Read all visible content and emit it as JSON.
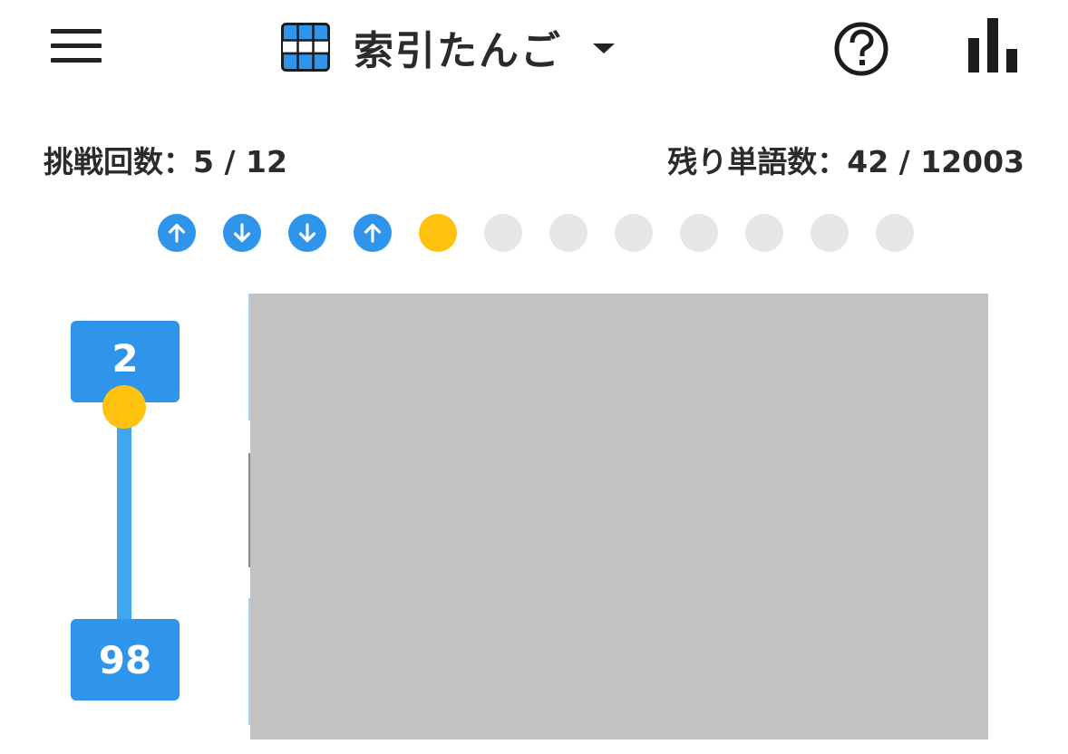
{
  "header": {
    "title": "索引たんご",
    "icons": {
      "menu": "hamburger-menu-icon",
      "mode": "grid-icon",
      "dropdown": "caret-down-icon",
      "help": "help-circle-icon",
      "stats": "bar-chart-icon"
    }
  },
  "status": {
    "attempts": "挑戦回数：5 / 12",
    "remaining": "残り単語数：42 / 12003"
  },
  "guesses": [
    {
      "state": "up",
      "icon": "arrow-up-icon"
    },
    {
      "state": "down",
      "icon": "arrow-down-icon"
    },
    {
      "state": "down",
      "icon": "arrow-down-icon"
    },
    {
      "state": "up",
      "icon": "arrow-up-icon"
    },
    {
      "state": "current"
    },
    {
      "state": "empty"
    },
    {
      "state": "empty"
    },
    {
      "state": "empty"
    },
    {
      "state": "empty"
    },
    {
      "state": "empty"
    },
    {
      "state": "empty"
    },
    {
      "state": "empty"
    }
  ],
  "range": {
    "top": "2",
    "bottom": "98"
  },
  "colors": {
    "primary": "#2e95ea",
    "track": "#42a5f0",
    "current": "#ffc20e",
    "empty": "#e6e6e6",
    "panel": "#c2c2c2",
    "text": "#2b2b2b"
  }
}
